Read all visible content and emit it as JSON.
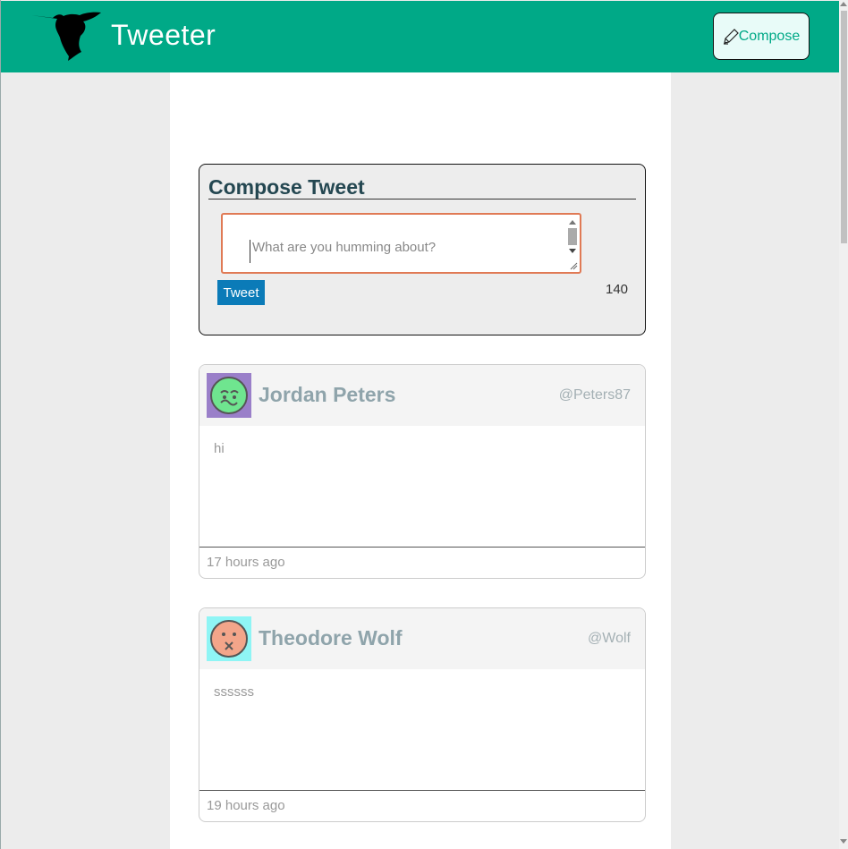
{
  "nav": {
    "brand": "Tweeter",
    "compose_label": "Compose",
    "logo_icon": "hummingbird-icon",
    "compose_icon": "pencil-icon",
    "color": "#00a987"
  },
  "composer": {
    "title": "Compose Tweet",
    "placeholder": "What are you humming about?",
    "tweet_label": "Tweet",
    "counter": "140"
  },
  "tweets": [
    {
      "name": "Jordan Peters",
      "handle": "@Peters87",
      "text": "hi",
      "time": "17 hours ago",
      "avatar_bg": "#9a7fc9"
    },
    {
      "name": "Theodore Wolf",
      "handle": "@Wolf",
      "text": "ssssss",
      "time": "19 hours ago",
      "avatar_bg": "#8ff5f5"
    }
  ]
}
